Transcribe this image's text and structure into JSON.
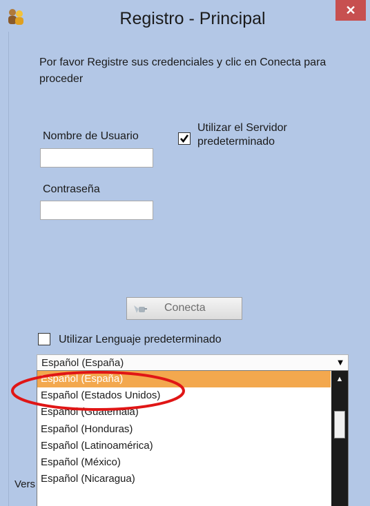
{
  "window": {
    "title": "Registro - Principal",
    "close_symbol": "✕"
  },
  "form": {
    "intro": "Por favor Registre sus credenciales y clic en Conecta para proceder",
    "username_label": "Nombre de Usuario",
    "username_value": "",
    "password_label": "Contraseña",
    "password_value": "",
    "default_server_label": "Utilizar el Servidor predeterminado",
    "default_server_checked": true,
    "connect_label": "Conecta",
    "default_language_label": "Utilizar Lenguaje predeterminado",
    "default_language_checked": false
  },
  "language_dropdown": {
    "selected": "Español (España)",
    "options": [
      "Español (España)",
      "Español (Estados Unidos)",
      "Español (Guatemala)",
      "Español (Honduras)",
      "Español (Latinoamérica)",
      "Español (México)",
      "Español (Nicaragua)"
    ],
    "highlight_color": "#f3a84e"
  },
  "footer": {
    "version_partial": "Vers"
  },
  "icons": {
    "app": "users-icon",
    "connect": "plug-icon",
    "close": "close-icon"
  },
  "colors": {
    "background": "#b3c7e6",
    "close_button": "#c75050",
    "annotation_ellipse": "#e01616"
  }
}
